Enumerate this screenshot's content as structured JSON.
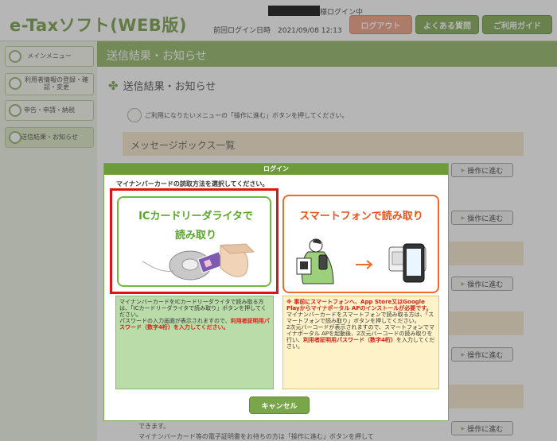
{
  "header": {
    "logo": "e-Taxソフト(WEB版)",
    "user_suffix": "様ログイン中",
    "last_login": "前回ログイン日時　2021/09/08 12:13",
    "logout": "ログアウト",
    "faq": "よくある質問",
    "guide": "ご利用ガイド"
  },
  "sidebar": {
    "items": [
      {
        "label": "メインメニュー"
      },
      {
        "label": "利用者情報の登録・確認・変更"
      },
      {
        "label": "申告・申請・納税"
      },
      {
        "label": "送信結果・お知らせ"
      }
    ]
  },
  "main": {
    "banner": "送信結果・お知らせ",
    "section_title": "送信結果・お知らせ",
    "instruction": "ご利用になりたいメニューの「操作に進む」ボタンを押してください。",
    "message_box": "メッセージボックス一覧",
    "go_label": "操作に進む",
    "bottom_line1": "できます。",
    "bottom_line2": "マイナンバーカード等の電子証明書をお持ちの方は「操作に進む」ボタンを押して"
  },
  "dialog": {
    "title": "ログイン",
    "prompt": "マイナンバーカードの読取方法を選択してください。",
    "ic_title_1": "ICカードリーダライタで",
    "ic_title_2": "読み取り",
    "sp_title": "スマートフォンで読み取り",
    "ic_desc_1": "マイナンバーカードをICカードリーダライタで読み取る方は、「ICカードリーダライタで読み取り」ボタンを押してください。",
    "ic_desc_2": "パスワードの入力画面が表示されますので、",
    "ic_desc_red": "利用者証明用パスワード（数字4桁）を入力してください。",
    "sp_desc_red": "※ 事前にスマートフォンへ、App Store又はGoogle Playからマイナポータル APのインストールが必要です。",
    "sp_desc_1": "マイナンバーカードをスマートフォンで読み取る方は、「スマートフォンで読み取り」ボタンを押してください。",
    "sp_desc_2": "2次元バーコードが表示されますので、スマートフォンでマイナポータル APを起動後、2次元バーコードの読み取りを行い、",
    "sp_desc_red2": "利用者証明用パスワード（数字4桁）",
    "sp_desc_3": "を入力してください。",
    "cancel": "キャンセル"
  },
  "colors": {
    "brand_green": "#6f9a3c",
    "logout_salmon": "#f09a7c",
    "ic_green": "#5aa52a",
    "sp_orange": "#e8521c",
    "highlight_red": "#e21212"
  }
}
